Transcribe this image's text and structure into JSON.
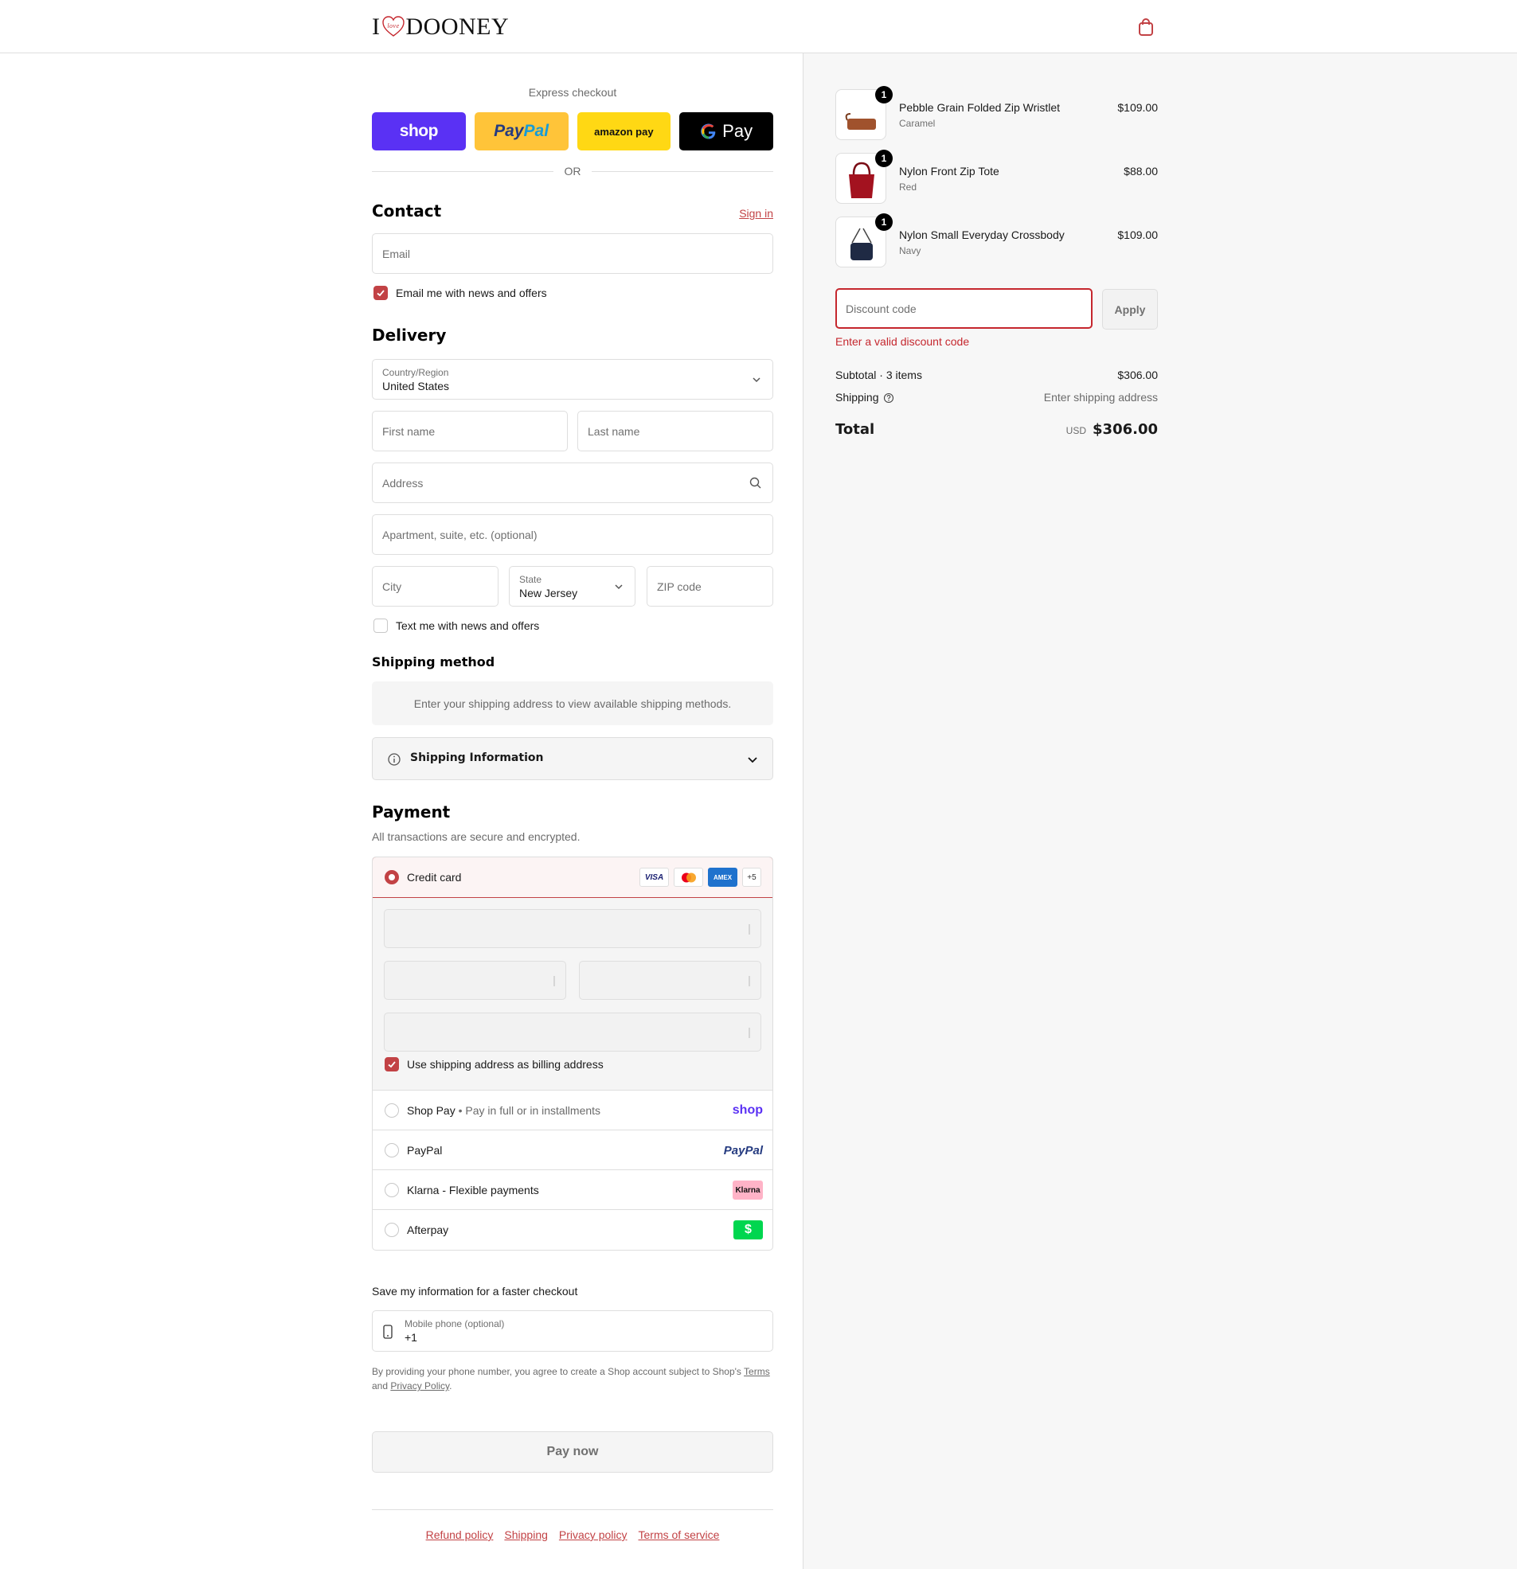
{
  "header": {
    "logo_text_left": "I",
    "logo_heart_text": "love",
    "logo_text_right": "DOONEY"
  },
  "express": {
    "label": "Express checkout",
    "shop": "shop",
    "paypal_a": "Pay",
    "paypal_b": "Pal",
    "amazon": "amazon pay",
    "gpay": "Pay",
    "or": "OR"
  },
  "contact": {
    "title": "Contact",
    "signin": "Sign in",
    "email_placeholder": "Email",
    "news_label": "Email me with news and offers"
  },
  "delivery": {
    "title": "Delivery",
    "country_label": "Country/Region",
    "country_value": "United States",
    "first_name": "First name",
    "last_name": "Last name",
    "address": "Address",
    "apartment": "Apartment, suite, etc. (optional)",
    "city": "City",
    "state_label": "State",
    "state_value": "New Jersey",
    "zip": "ZIP code",
    "text_label": "Text me with news and offers"
  },
  "shipping": {
    "title": "Shipping method",
    "note": "Enter your shipping address to view available shipping methods.",
    "info": "Shipping Information"
  },
  "payment": {
    "title": "Payment",
    "subtitle": "All transactions are secure and encrypted.",
    "credit_card": "Credit card",
    "cards": [
      "VISA",
      "MC",
      "AMEX",
      "+5"
    ],
    "billing_label": "Use shipping address as billing address",
    "methods": [
      {
        "name": "Shop Pay",
        "sep": " • ",
        "detail": "Pay in full or in installments",
        "logo": "shop"
      },
      {
        "name": "PayPal",
        "logo": "PayPal"
      },
      {
        "name": "Klarna - Flexible payments",
        "logo": "Klarna"
      },
      {
        "name": "Afterpay",
        "logo": "$"
      }
    ]
  },
  "save": {
    "title": "Save my information for a faster checkout",
    "phone_label": "Mobile phone (optional)",
    "phone_value": "+1",
    "legal_a": "By providing your phone number, you agree to create a Shop account subject to Shop's ",
    "legal_terms": "Terms",
    "legal_b": " and ",
    "legal_privacy": "Privacy Policy",
    "legal_c": "."
  },
  "pay_now": "Pay now",
  "footer": [
    "Refund policy",
    "Shipping",
    "Privacy policy",
    "Terms of service"
  ],
  "summary": {
    "items": [
      {
        "qty": "1",
        "name": "Pebble Grain Folded Zip Wristlet",
        "variant": "Caramel",
        "price": "$109.00",
        "color": "#a0522d"
      },
      {
        "qty": "1",
        "name": "Nylon Front Zip Tote",
        "variant": "Red",
        "price": "$88.00",
        "color": "#a3121f"
      },
      {
        "qty": "1",
        "name": "Nylon Small Everyday Crossbody",
        "variant": "Navy",
        "price": "$109.00",
        "color": "#1f2a44"
      }
    ],
    "discount_placeholder": "Discount code",
    "apply": "Apply",
    "discount_error": "Enter a valid discount code",
    "subtotal_label": "Subtotal · 3 items",
    "subtotal_value": "$306.00",
    "shipping_label": "Shipping",
    "shipping_value": "Enter shipping address",
    "total_label": "Total",
    "total_currency": "USD",
    "total_value": "$306.00"
  },
  "colors": {
    "accent": "#c24245",
    "error": "#c5272e",
    "shop_purple": "#5a31f4",
    "paypal_yellow": "#ffc439",
    "amazon_yellow": "#ffd814"
  }
}
